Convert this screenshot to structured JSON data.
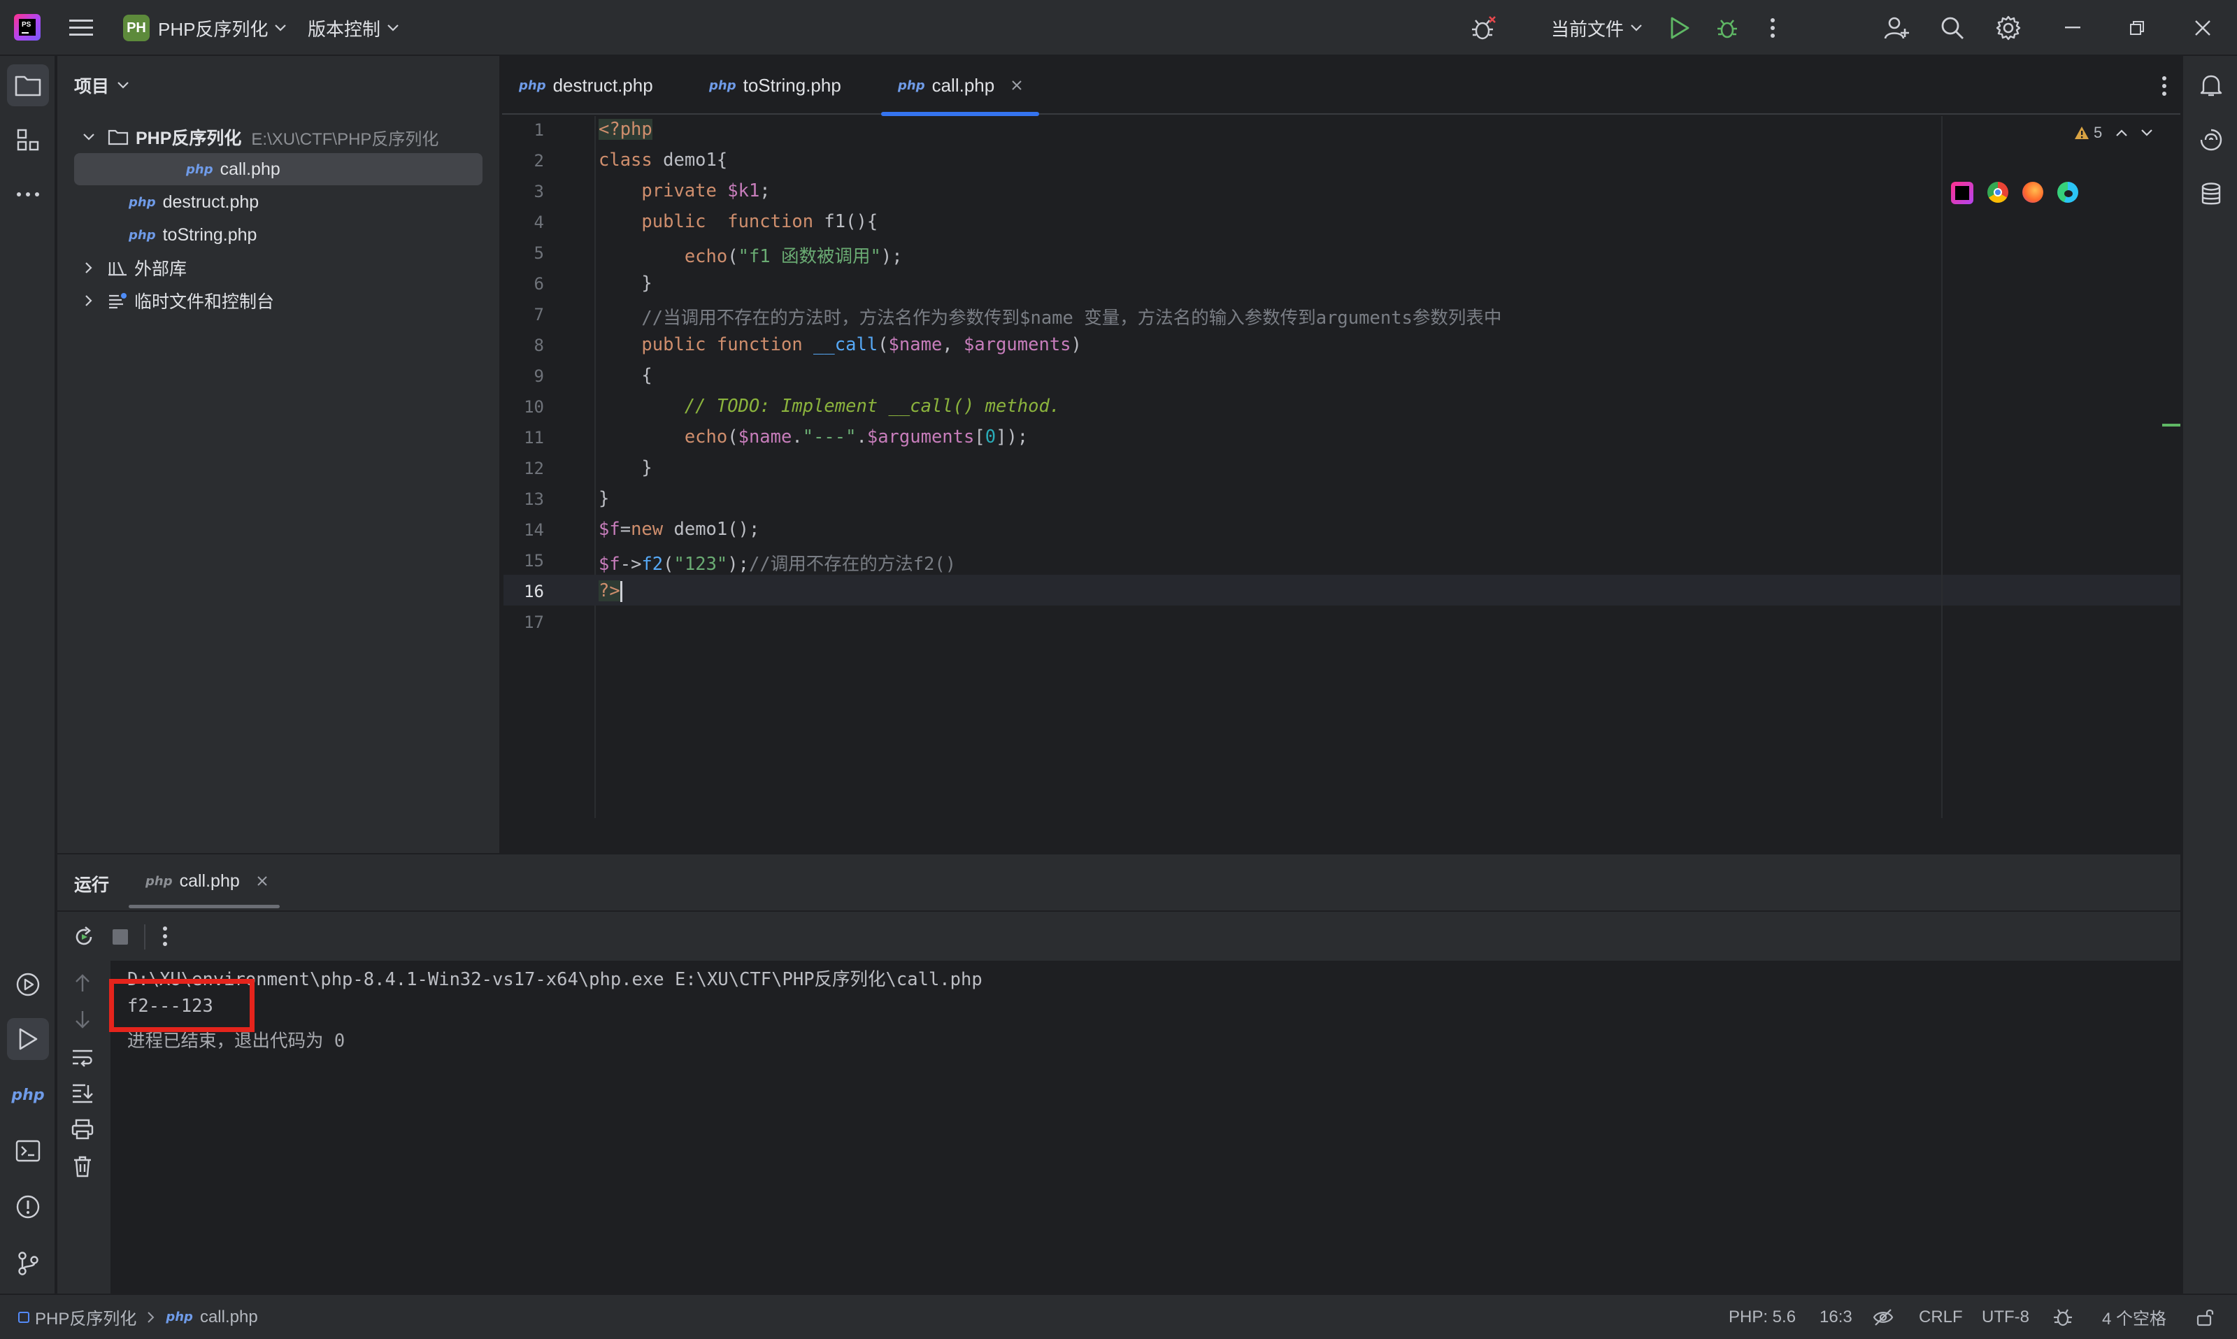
{
  "titlebar": {
    "project_badge": "PH",
    "project_name": "PHP反序列化",
    "vcs_label": "版本控制",
    "run_config": "当前文件"
  },
  "project_panel": {
    "header": "项目",
    "root_name": "PHP反序列化",
    "root_path": "E:\\XU\\CTF\\PHP反序列化",
    "files": [
      "call.php",
      "destruct.php",
      "toString.php"
    ],
    "external_libs": "外部库",
    "scratches": "临时文件和控制台",
    "php_badge": "php"
  },
  "tabs": [
    {
      "label": "destruct.php"
    },
    {
      "label": "toString.php"
    },
    {
      "label": "call.php"
    }
  ],
  "editor": {
    "warning_count": "5",
    "line_numbers": [
      "1",
      "2",
      "3",
      "4",
      "5",
      "6",
      "7",
      "8",
      "9",
      "10",
      "11",
      "12",
      "13",
      "14",
      "15",
      "16",
      "17"
    ],
    "current_line": "16"
  },
  "run_panel": {
    "title": "运行",
    "tab_label": "call.php",
    "command_line": "D:\\XU\\environment\\php-8.4.1-Win32-vs17-x64\\php.exe E:\\XU\\CTF\\PHP反序列化\\call.php",
    "output_line": "f2---123",
    "exit_line": "进程已结束，退出代码为 0"
  },
  "statusbar": {
    "breadcrumb_project": "PHP反序列化",
    "breadcrumb_file": "call.php",
    "php_level": "PHP: 5.6",
    "caret": "16:3",
    "line_sep": "CRLF",
    "encoding": "UTF-8",
    "indent": "4 个空格"
  },
  "colors": {
    "accent": "#3574f0",
    "highlight_box": "#e5241c",
    "run_green": "#5fb865"
  }
}
